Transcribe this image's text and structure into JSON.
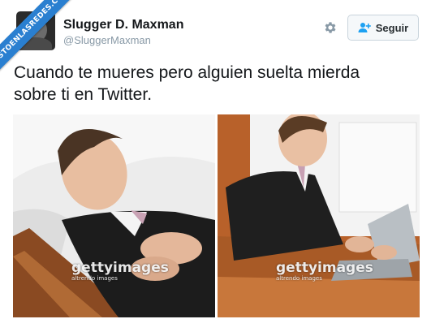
{
  "watermark": {
    "text": "VISTOENLASREDES.COM"
  },
  "tweet": {
    "display_name": "Slugger D. Maxman",
    "handle": "@SluggerMaxman",
    "follow_label": "Seguir",
    "text_line1": "Cuando te mueres pero alguien suelta mierda",
    "text_line2": "sobre ti en Twitter."
  },
  "photos": [
    {
      "brand": "gettyimages",
      "credit": "altrendo images"
    },
    {
      "brand": "gettyimages",
      "credit": "altrendo images"
    }
  ],
  "colors": {
    "accent": "#1da1f2",
    "ribbon": "#2a7fd0",
    "text": "#14171a",
    "muted": "#8899a6"
  },
  "icons": [
    "gear-icon",
    "add-user-icon"
  ]
}
